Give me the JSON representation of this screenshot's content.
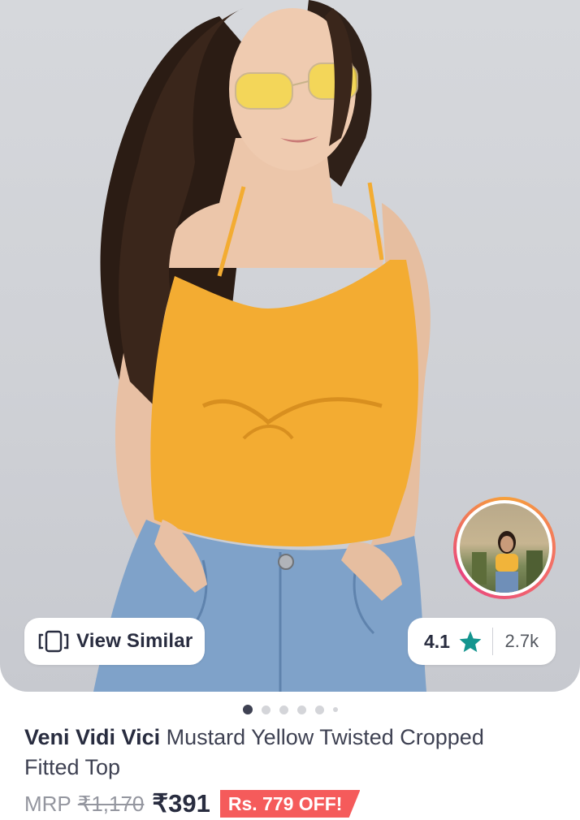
{
  "product": {
    "brand": "Veni Vidi Vici",
    "name": "Mustard Yellow Twisted Cropped Fitted Top",
    "mrp_label": "MRP",
    "mrp": "₹1,170",
    "price": "₹391",
    "discount": "Rs. 779 OFF!"
  },
  "actions": {
    "view_similar_label": "View Similar"
  },
  "rating": {
    "value": "4.1",
    "count": "2.7k",
    "star_color": "#14958f"
  },
  "carousel": {
    "total_dots": 6,
    "active_index": 0
  },
  "colors": {
    "discount_bg": "#f55b5b",
    "text_primary": "#282c3f"
  },
  "icons": {
    "view_similar": "view-similar-icon",
    "rating_star": "star-icon"
  }
}
